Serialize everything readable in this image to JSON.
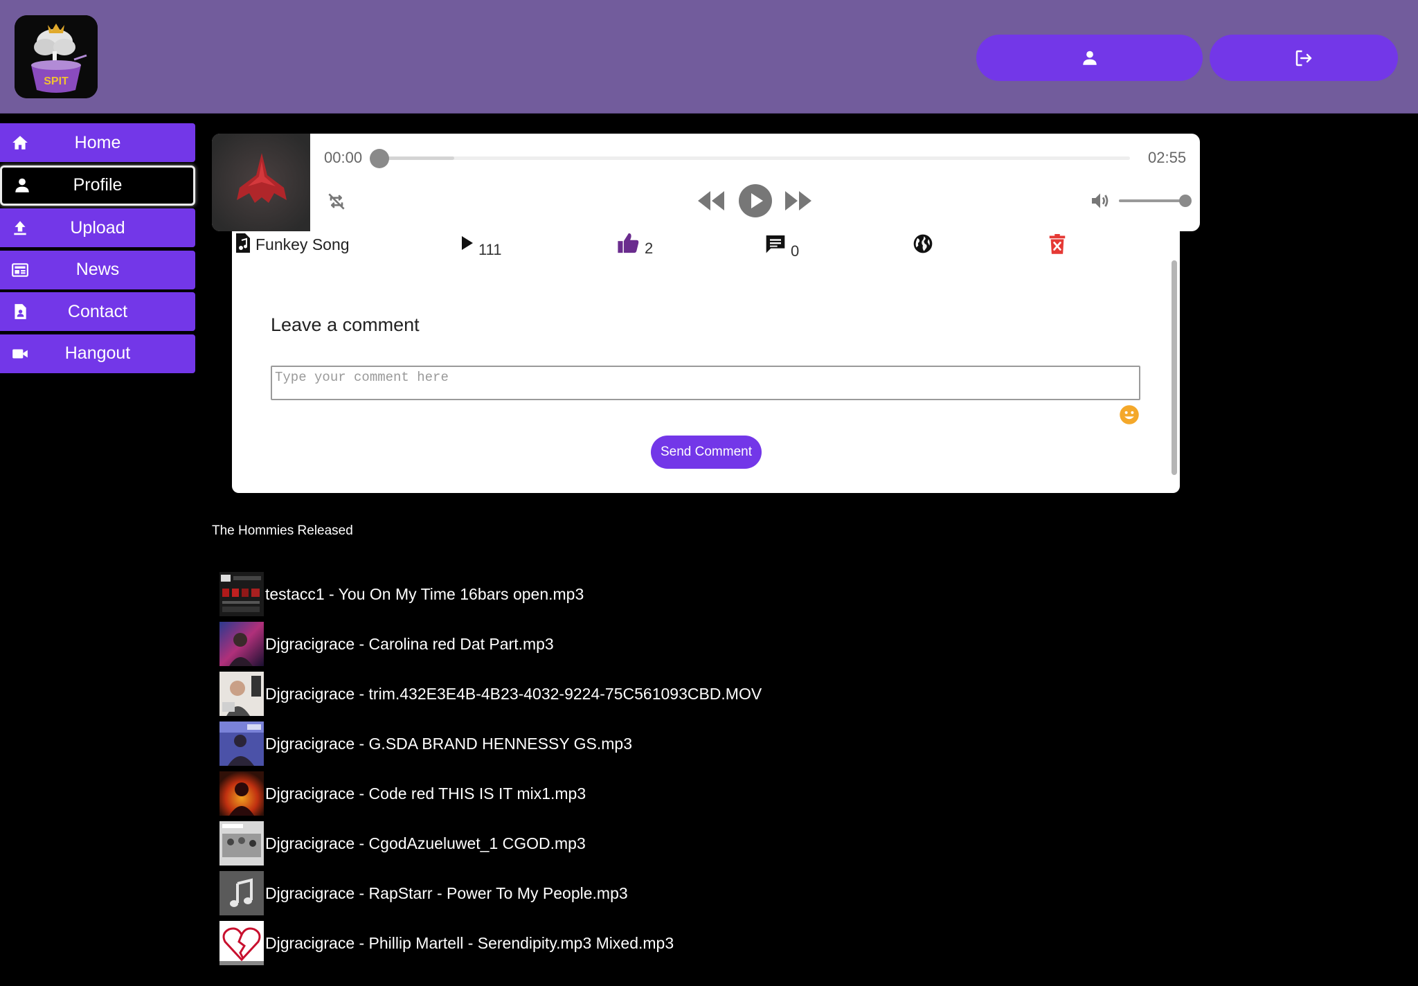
{
  "header": {
    "logo_name": "app-logo",
    "buttons": [
      {
        "icon": "person-icon"
      },
      {
        "icon": "logout-icon"
      }
    ]
  },
  "sidebar": {
    "items": [
      {
        "label": "Home",
        "icon": "home-icon",
        "active": false
      },
      {
        "label": "Profile",
        "icon": "person-icon",
        "active": true
      },
      {
        "label": "Upload",
        "icon": "upload-icon",
        "active": false
      },
      {
        "label": "News",
        "icon": "news-icon",
        "active": false
      },
      {
        "label": "Contact",
        "icon": "contact-icon",
        "active": false
      },
      {
        "label": "Hangout",
        "icon": "video-camera-icon",
        "active": false
      }
    ]
  },
  "player": {
    "current_time": "00:00",
    "duration": "02:55",
    "progress_fraction": 0.0,
    "buffered_fraction": 0.1,
    "volume_fraction": 1.0
  },
  "track": {
    "title": "Funkey Song",
    "plays": "111",
    "likes": "2",
    "comments": "0"
  },
  "comment_form": {
    "title": "Leave a comment",
    "placeholder": "Type your comment here",
    "send_label": "Send Comment"
  },
  "releases": {
    "title": "The Hommies Released",
    "items": [
      "testacc1 - You On My Time 16bars open.mp3",
      "Djgracigrace - Carolina red Dat Part.mp3",
      "Djgracigrace - trim.432E3E4B-4B23-4032-9224-75C561093CBD.MOV",
      "Djgracigrace - G.SDA BRAND HENNESSY GS.mp3",
      "Djgracigrace - Code red THIS IS IT mix1.mp3",
      "Djgracigrace - CgodAzueluwet_1 CGOD.mp3",
      "Djgracigrace - RapStarr - Power To My People.mp3",
      "Djgracigrace - Phillip Martell - Serendipity.mp3 Mixed.mp3"
    ]
  },
  "colors": {
    "accent": "#7337e8",
    "header_bg": "#725c9c",
    "delete": "#e53935",
    "like": "#6a2c8e",
    "emoji": "#f4a82a"
  }
}
